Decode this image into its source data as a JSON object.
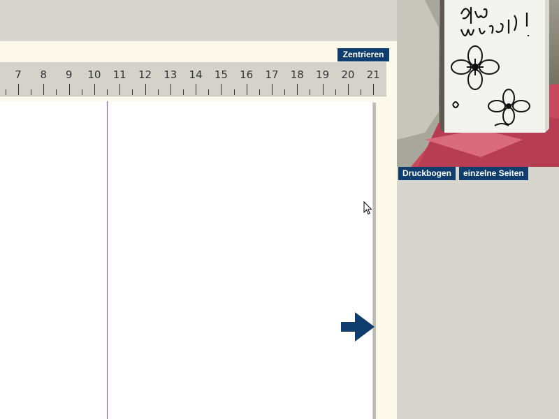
{
  "toolbar": {
    "center_label": "Zentrieren"
  },
  "ruler": {
    "unit": "cm",
    "labels": [
      "7",
      "8",
      "9",
      "10",
      "11",
      "12",
      "13",
      "14",
      "15",
      "16",
      "17",
      "18",
      "19",
      "20",
      "21"
    ]
  },
  "preview": {
    "card_text": "Glück wunsch!",
    "tabs": {
      "print_sheet": "Druckbogen",
      "single_pages": "einzelne Seiten"
    }
  },
  "icons": {
    "next": "arrow-right-icon",
    "pointer": "mouse-cursor-icon"
  },
  "colors": {
    "accent": "#0e3d6e",
    "fold_line": "#c040a8",
    "workspace": "#fdf9ea",
    "envelope": "#c8485c"
  }
}
